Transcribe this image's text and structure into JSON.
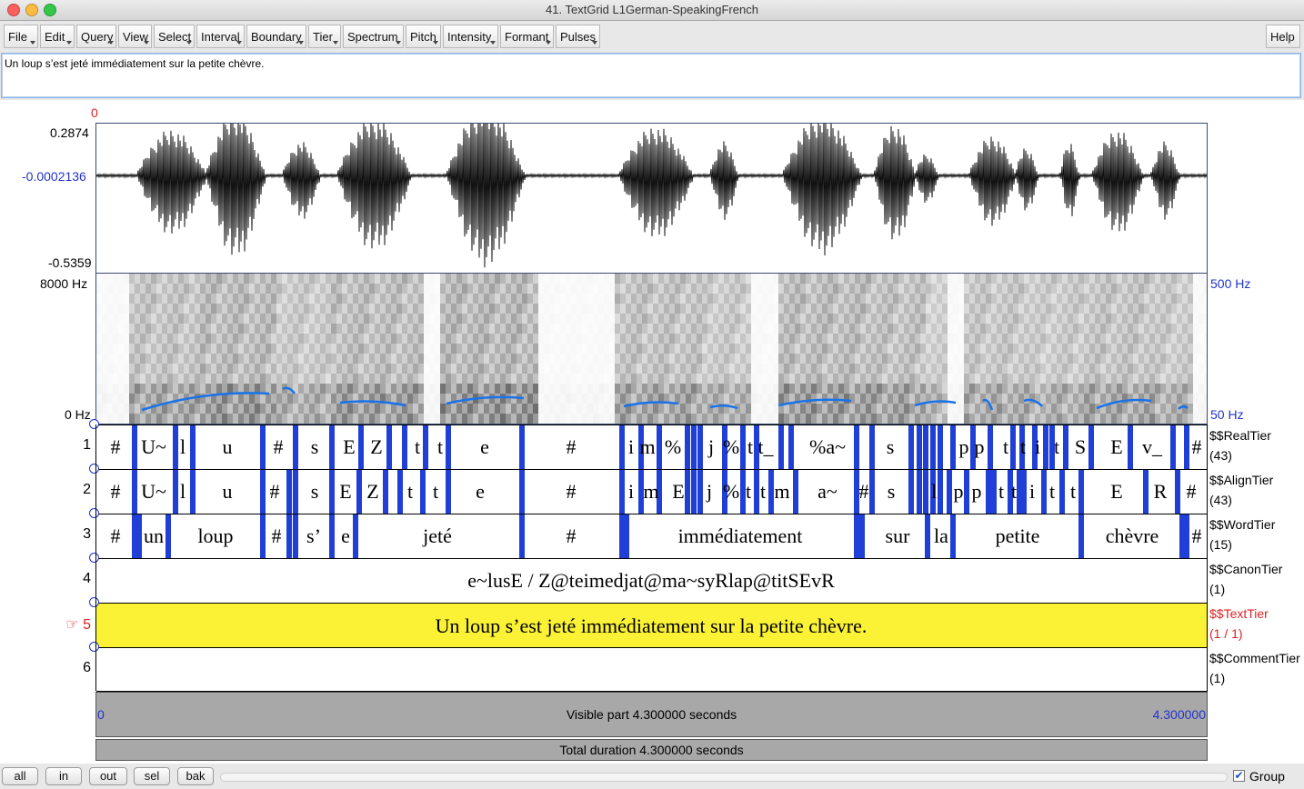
{
  "window": {
    "title": "41. TextGrid L1German-SpeakingFrench"
  },
  "menu": [
    "File",
    "Edit",
    "Query",
    "View",
    "Select",
    "Interval",
    "Boundary",
    "Tier",
    "Spectrum",
    "Pitch",
    "Intensity",
    "Formant",
    "Pulses"
  ],
  "help": "Help",
  "text_box": "Un loup s’est jeté immédiatement sur la petite chèvre.",
  "waveform": {
    "cursor_time": "0",
    "max": "0.2874",
    "mid": "-0.0002136",
    "min": "-0.5359"
  },
  "spectrogram": {
    "top": "8000 Hz",
    "bottom": "0 Hz",
    "pitch_top": "500 Hz",
    "pitch_bottom": "50 Hz"
  },
  "colors": {
    "boundary": "#1f3fd6",
    "selected_tier": "#fbf236",
    "selected_text": "#dd2222",
    "axis_blue": "#2233cc"
  },
  "tiers": [
    {
      "num": "1",
      "name": "$$RealTier",
      "count": "(43)",
      "labels": [
        [
          "#",
          127
        ],
        [
          "U~",
          169
        ],
        [
          "l",
          201
        ],
        [
          "u",
          250
        ],
        [
          "#",
          306
        ],
        [
          "s",
          346
        ],
        [
          "E",
          384
        ],
        [
          "Z",
          414
        ],
        [
          "t",
          459
        ],
        [
          "t",
          484
        ],
        [
          "e",
          533
        ],
        [
          "#",
          628
        ],
        [
          "i",
          694
        ],
        [
          "m",
          712
        ],
        [
          "%",
          740
        ],
        [
          "j",
          782
        ],
        [
          "%",
          804
        ],
        [
          "t",
          825
        ],
        [
          "t_",
          842
        ],
        [
          "%a~",
          910
        ],
        [
          "s",
          979
        ],
        [
          "p",
          1060
        ],
        [
          "p",
          1077
        ],
        [
          "t",
          1106
        ],
        [
          "t",
          1125
        ],
        [
          "i",
          1141
        ],
        [
          "t",
          1162
        ],
        [
          "S",
          1188
        ],
        [
          "E",
          1228
        ],
        [
          "v_",
          1267
        ],
        [
          "#",
          1316
        ]
      ],
      "bounds": [
        148,
        193,
        212,
        289,
        325,
        365,
        397,
        428,
        445,
        468,
        493,
        574,
        684,
        705,
        725,
        756,
        763,
        770,
        797,
        817,
        832,
        859,
        870,
        942,
        959,
        1002,
        1011,
        1018,
        1026,
        1034,
        1048,
        1070,
        1089,
        1114,
        1124,
        1138,
        1150,
        1157,
        1172,
        1200,
        1243,
        1290,
        1305
      ]
    },
    {
      "num": "2",
      "name": "$$AlignTier",
      "count": "(43)",
      "labels": [
        [
          "#",
          127
        ],
        [
          "U~",
          169
        ],
        [
          "l",
          201
        ],
        [
          "u",
          250
        ],
        [
          "#",
          302
        ],
        [
          "s",
          346
        ],
        [
          "E",
          380
        ],
        [
          "Z",
          410
        ],
        [
          "t",
          451
        ],
        [
          "t",
          479
        ],
        [
          "e",
          528
        ],
        [
          "#",
          628
        ],
        [
          "i",
          694
        ],
        [
          "m",
          716
        ],
        [
          "E",
          746
        ],
        [
          "j",
          780
        ],
        [
          "%",
          804
        ],
        [
          "t",
          823
        ],
        [
          "t",
          839
        ],
        [
          "m",
          860
        ],
        [
          "a~",
          910
        ],
        [
          "#",
          950
        ],
        [
          "s",
          980
        ],
        [
          "l",
          1027
        ],
        [
          "p",
          1054
        ],
        [
          "p",
          1074
        ],
        [
          "t",
          1101
        ],
        [
          "t",
          1115
        ],
        [
          "i",
          1135
        ],
        [
          "t",
          1157
        ],
        [
          "t",
          1180
        ],
        [
          "E",
          1228
        ],
        [
          "R",
          1276
        ],
        [
          "#",
          1310
        ]
      ],
      "bounds": [
        148,
        193,
        212,
        289,
        318,
        325,
        365,
        395,
        424,
        440,
        465,
        493,
        574,
        684,
        705,
        725,
        756,
        763,
        770,
        797,
        817,
        832,
        848,
        875,
        942,
        959,
        1002,
        1011,
        1018,
        1026,
        1034,
        1044,
        1063,
        1087,
        1093,
        1111,
        1121,
        1126,
        1148,
        1168,
        1189,
        1260,
        1295
      ]
    },
    {
      "num": "3",
      "name": "$$WordTier",
      "count": "(15)",
      "labels": [
        [
          "#",
          127
        ],
        [
          "un",
          169
        ],
        [
          "loup",
          237
        ],
        [
          "#",
          304
        ],
        [
          "s’",
          345
        ],
        [
          "e",
          380
        ],
        [
          "jeté",
          481
        ],
        [
          "#",
          628
        ],
        [
          "immédiatement",
          814
        ],
        [
          "sur",
          987
        ],
        [
          "la",
          1035
        ],
        [
          "petite",
          1119
        ],
        [
          "chèvre",
          1245
        ],
        [
          "#",
          1316
        ]
      ],
      "bounds": [
        148,
        153,
        185,
        289,
        318,
        325,
        365,
        391,
        574,
        684,
        689,
        942,
        948,
        1020,
        1048,
        1189,
        1300,
        1305
      ]
    },
    {
      "num": "4",
      "name": "$$CanonTier",
      "count": "(1)",
      "labels": [
        [
          "e~lusE / Z@teimedjat@ma~syRlap@titSEvR",
          716
        ]
      ],
      "bounds": []
    },
    {
      "num": "5",
      "name": "$$TextTier",
      "count": "(1 / 1)",
      "labels": [
        [
          "Un loup s’est jeté immédiatement sur la petite chèvre.",
          716
        ]
      ],
      "bounds": []
    },
    {
      "num": "6",
      "name": "$$CommentTier",
      "count": "(1)",
      "labels": [],
      "bounds": []
    }
  ],
  "time_axis": {
    "start": "0",
    "end": "4.300000",
    "visible": "Visible part 4.300000 seconds",
    "total": "Total duration 4.300000 seconds"
  },
  "bottom_buttons": [
    "all",
    "in",
    "out",
    "sel",
    "bak"
  ],
  "group": {
    "label": "Group",
    "checked": true
  }
}
